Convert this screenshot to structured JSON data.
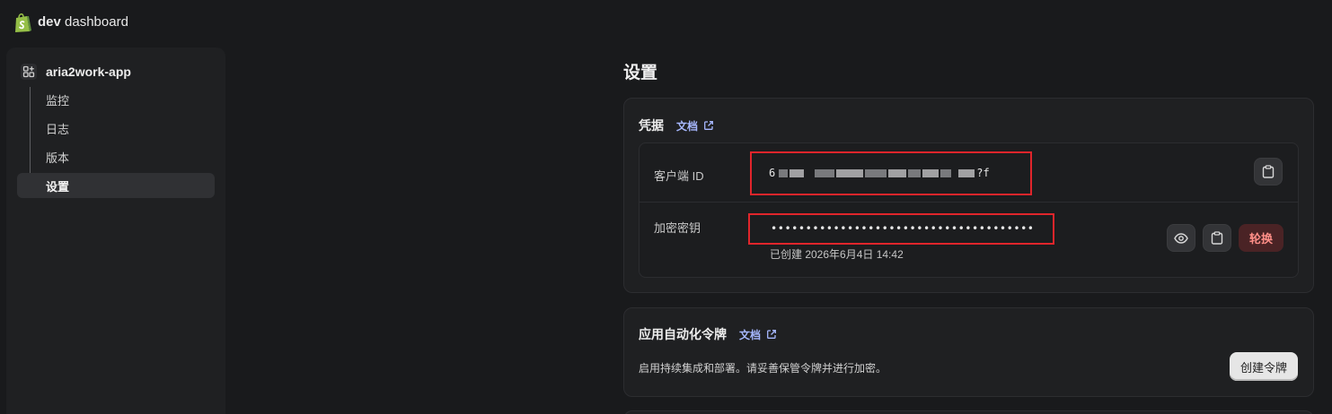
{
  "header": {
    "brand_bold": "dev",
    "brand_rest": " dashboard"
  },
  "sidebar": {
    "app_name": "aria2work-app",
    "items": [
      {
        "label": "监控"
      },
      {
        "label": "日志"
      },
      {
        "label": "版本"
      },
      {
        "label": "设置",
        "active": true
      }
    ]
  },
  "page": {
    "title": "设置"
  },
  "credentials": {
    "title": "凭据",
    "docs_label": "文档",
    "client_id_label": "客户端 ID",
    "client_id_start": "6",
    "client_id_end": "?f",
    "secret_label": "加密密钥",
    "secret_value": "••••••••••••••••••••••••••••••••••••••",
    "created": "已创建 2026年6月4日 14:42",
    "rotate_label": "轮换"
  },
  "automation": {
    "title": "应用自动化令牌",
    "docs_label": "文档",
    "description": "启用持续集成和部署。请妥善保管令牌并进行加密。",
    "create_label": "创建令牌"
  },
  "icons": {
    "logo": "shopify-bag-icon",
    "app": "app-grid-icon",
    "external": "external-link-icon",
    "copy": "clipboard-icon",
    "reveal": "eye-icon"
  },
  "colors": {
    "background": "#191a1c",
    "panel": "#1f2022",
    "accent_link": "#a7b8ff",
    "logo_green": "#95bf47",
    "danger": "#4a2325",
    "highlight": "#e0252b"
  }
}
